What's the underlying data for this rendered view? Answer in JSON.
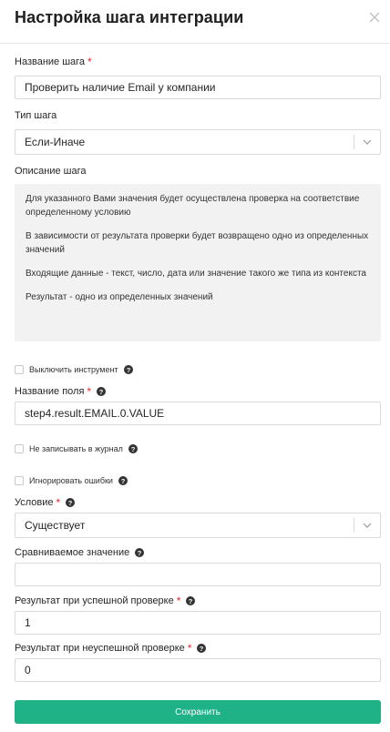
{
  "header": {
    "title": "Настройка шага интеграции"
  },
  "step_name": {
    "label": "Название шага",
    "required_mark": "*",
    "value": "Проверить наличие Email у компании"
  },
  "step_type": {
    "label": "Тип шага",
    "value": "Если-Иначе"
  },
  "step_description": {
    "label": "Описание шага",
    "paragraphs": [
      "Для указанного Вами значения будет осуществлена проверка на соответствие определенному условию",
      "В зависимости от результата проверки будет возвращено одно из определенных значений",
      "Входящие данные - текст, число, дата или значение такого же типа из контекста",
      "Результат - одно из определенных значений"
    ]
  },
  "disable_tool": {
    "label": "Выключить инструмент",
    "checked": false
  },
  "field_name": {
    "label": "Название поля",
    "required_mark": "*",
    "value": "step4.result.EMAIL.0.VALUE"
  },
  "no_log": {
    "label": "Не записывать в журнал",
    "checked": false
  },
  "ignore_errors": {
    "label": "Игнорировать ошибки",
    "checked": false
  },
  "condition": {
    "label": "Условие",
    "required_mark": "*",
    "value": "Существует"
  },
  "compare_value": {
    "label": "Сравниваемое значение",
    "value": ""
  },
  "success_result": {
    "label": "Результат при успешной проверке",
    "required_mark": "*",
    "value": "1"
  },
  "fail_result": {
    "label": "Результат при неуспешной проверке",
    "required_mark": "*",
    "value": "0"
  },
  "save_button": {
    "label": "Сохранить"
  },
  "colors": {
    "accent": "#20b287",
    "required": "#f5222d",
    "description_bg": "#f2f2f2"
  }
}
